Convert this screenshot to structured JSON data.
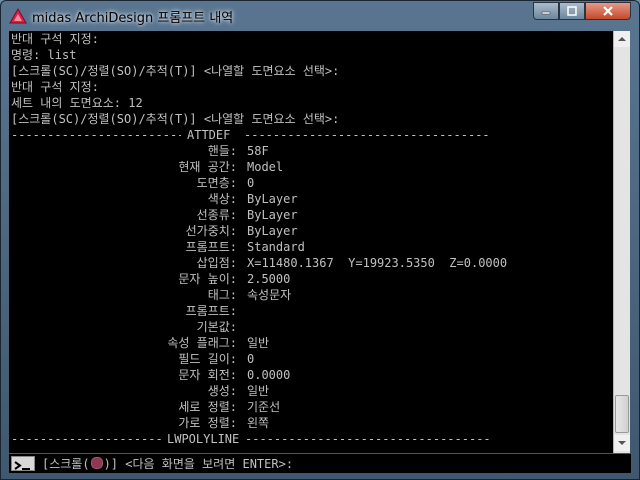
{
  "window": {
    "title": "midas ArchiDesign 프롬프트 내역"
  },
  "history": [
    "반대 구석 지정:",
    "명령: list",
    "[스크롤(SC)/정렬(SO)/추적(T)] <나열할 도면요소 선택>:",
    "반대 구석 지정:",
    "세트 내의 도면요소: 12",
    "[스크롤(SC)/정렬(SO)/추적(T)] <나열할 도면요소 선택>:"
  ],
  "separator_top": "ATTDEF",
  "separator_bottom": "LWPOLYLINE",
  "properties": [
    {
      "label": "핸들:",
      "value": "58F"
    },
    {
      "label": "현재 공간:",
      "value": "Model"
    },
    {
      "label": "도면층:",
      "value": "0"
    },
    {
      "label": "색상:",
      "value": "ByLayer"
    },
    {
      "label": "선종류:",
      "value": "ByLayer"
    },
    {
      "label": "선가중치:",
      "value": "ByLayer"
    },
    {
      "label": "프롬프트:",
      "value": "Standard"
    },
    {
      "label": "삽입점:",
      "value": "X=11480.1367  Y=19923.5350  Z=0.0000"
    },
    {
      "label": "문자 높이:",
      "value": "2.5000"
    },
    {
      "label": "태그:",
      "value": "속성문자"
    },
    {
      "label": "프롬프트:",
      "value": ""
    },
    {
      "label": "기본값:",
      "value": ""
    },
    {
      "label": "속성 플래그:",
      "value": "일반"
    },
    {
      "label": "필드 길이:",
      "value": "0"
    },
    {
      "label": "문자 회전:",
      "value": "0.0000"
    },
    {
      "label": "생성:",
      "value": "일반"
    },
    {
      "label": "세로 정렬:",
      "value": "기준선"
    },
    {
      "label": "가로 정렬:",
      "value": "왼쪽"
    }
  ],
  "command": {
    "prefix": "[스크롤(",
    "suffix": ")] <다음 화면을 보려면 ENTER>:"
  },
  "colors": {
    "console_bg": "#000000",
    "console_text": "#c0c0c0",
    "app_icon": "#e0204a"
  },
  "icons": [
    "app-logo-icon",
    "minimize-icon",
    "maximize-icon",
    "close-icon",
    "scroll-up-icon",
    "scroll-down-icon",
    "command-prompt-icon",
    "marker-icon"
  ]
}
